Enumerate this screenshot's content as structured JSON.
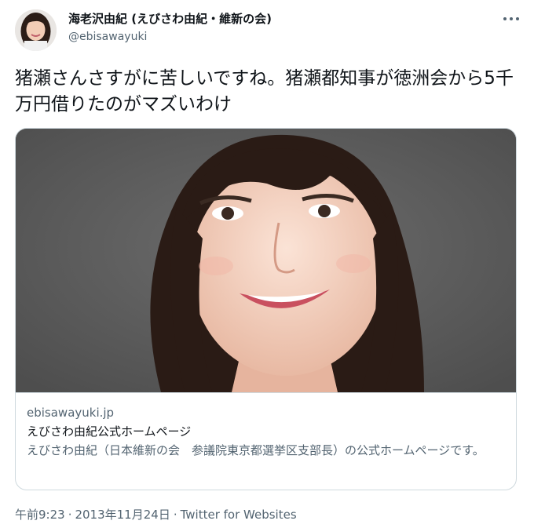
{
  "author": {
    "display_name": "海老沢由紀 (えびさわ由紀・維新の会)",
    "handle": "@ebisawayuki"
  },
  "tweet": {
    "text": "猪瀬さんさすがに苦しいですね。猪瀬都知事が徳洲会から5千万円借りたのがマズいわけ"
  },
  "card": {
    "domain": "ebisawayuki.jp",
    "title": "えびさわ由紀公式ホームページ",
    "description": "えびさわ由紀（日本維新の会　参議院東京都選挙区支部長）の公式ホームページです。"
  },
  "meta": {
    "time": "午前9:23",
    "separator": "·",
    "date": "2013年11月24日",
    "source": "Twitter for Websites"
  },
  "icons": {
    "more": "more-horizontal-icon"
  },
  "colors": {
    "text_primary": "#0f1419",
    "text_secondary": "#536471",
    "border": "#cfd9de"
  }
}
